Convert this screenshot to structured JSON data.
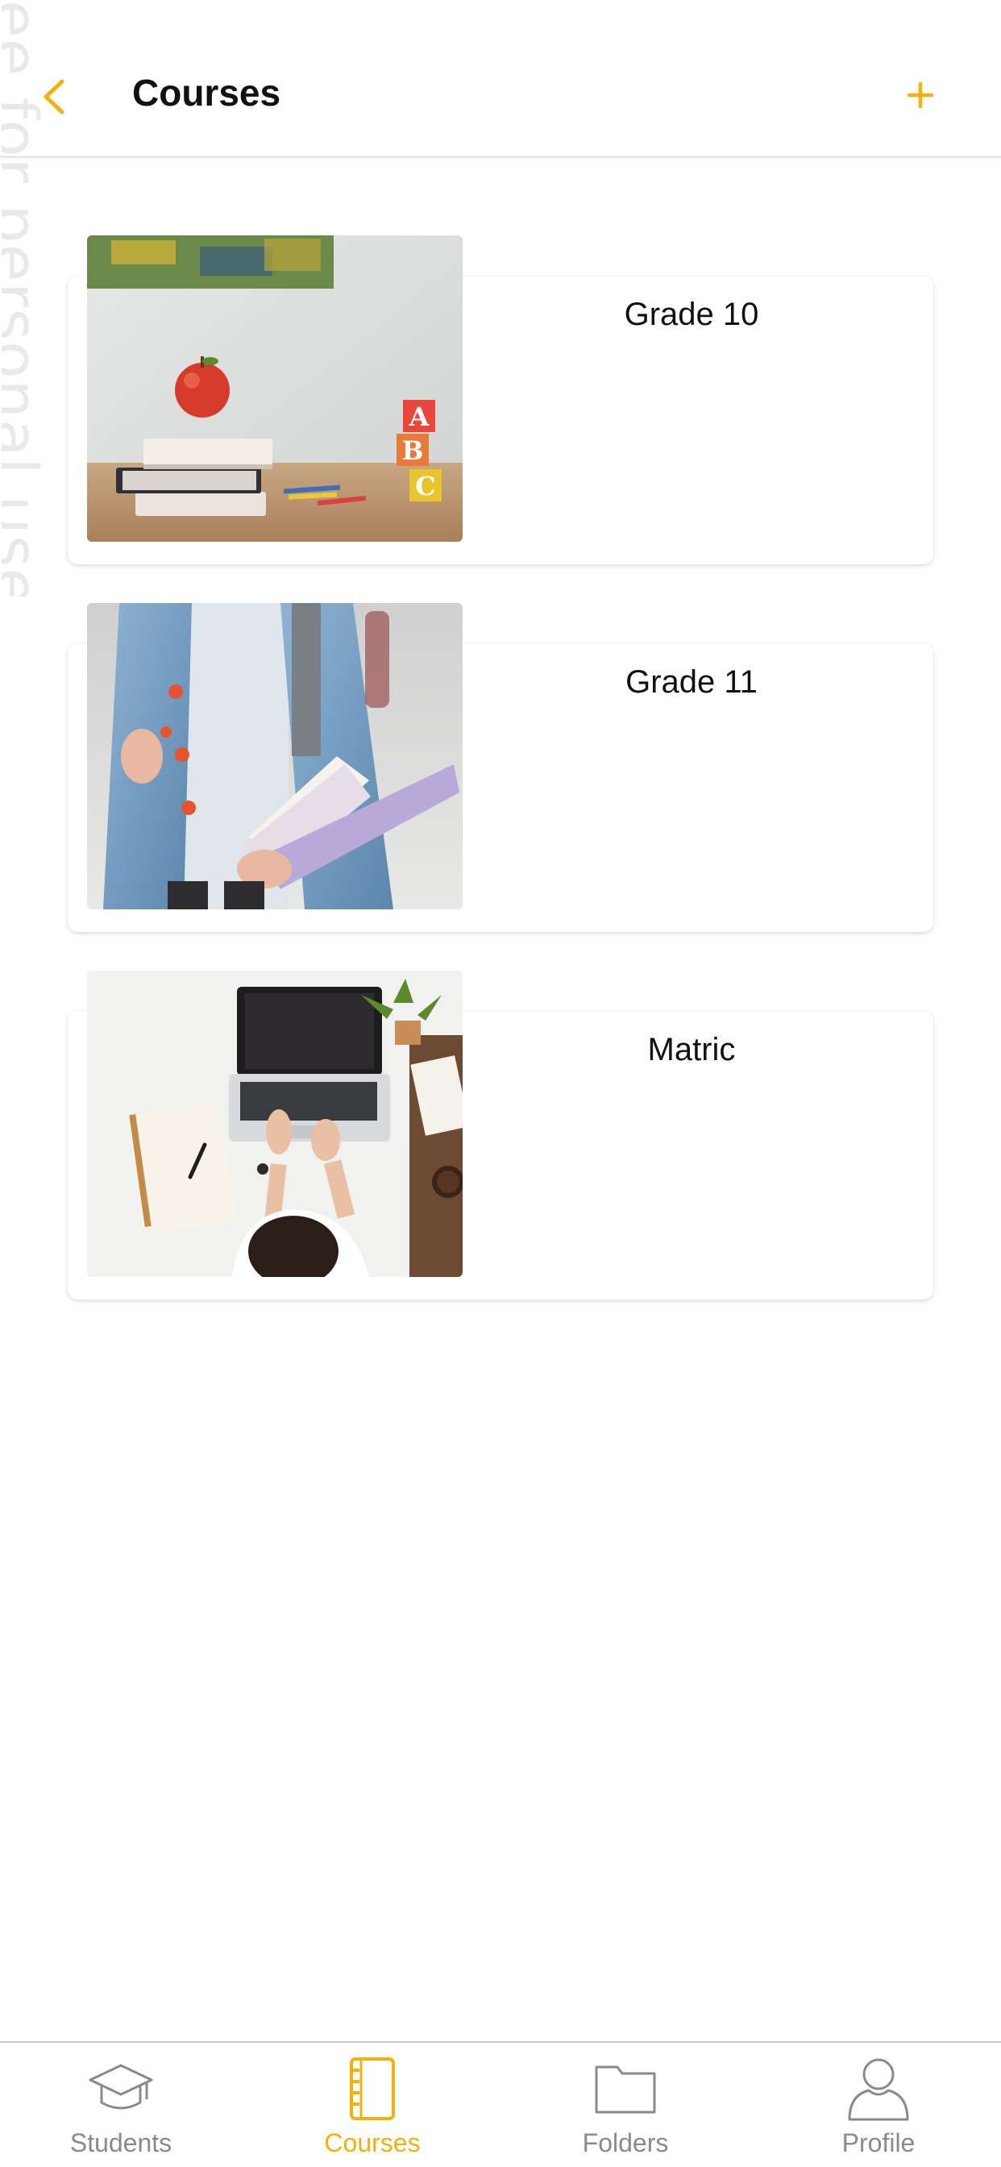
{
  "watermark": {
    "text": "ee for personal use"
  },
  "header": {
    "title": "Courses",
    "back_icon": "chevron-left-icon",
    "add_icon": "plus-icon"
  },
  "courses": [
    {
      "name": "Grade 10",
      "image": "apple-books-abc-blocks-photo"
    },
    {
      "name": "Grade 11",
      "image": "student-holding-books-photo"
    },
    {
      "name": "Matric",
      "image": "student-laptop-desk-photo"
    }
  ],
  "bottom_nav": {
    "items": [
      {
        "label": "Students",
        "icon": "graduation-cap-icon",
        "active": false
      },
      {
        "label": "Courses",
        "icon": "notebook-icon",
        "active": true
      },
      {
        "label": "Folders",
        "icon": "folder-icon",
        "active": false
      },
      {
        "label": "Profile",
        "icon": "user-icon",
        "active": false
      }
    ]
  },
  "colors": {
    "accent": "#f2b10d",
    "inactive": "#8a8a8e",
    "background": "#ffffff"
  }
}
